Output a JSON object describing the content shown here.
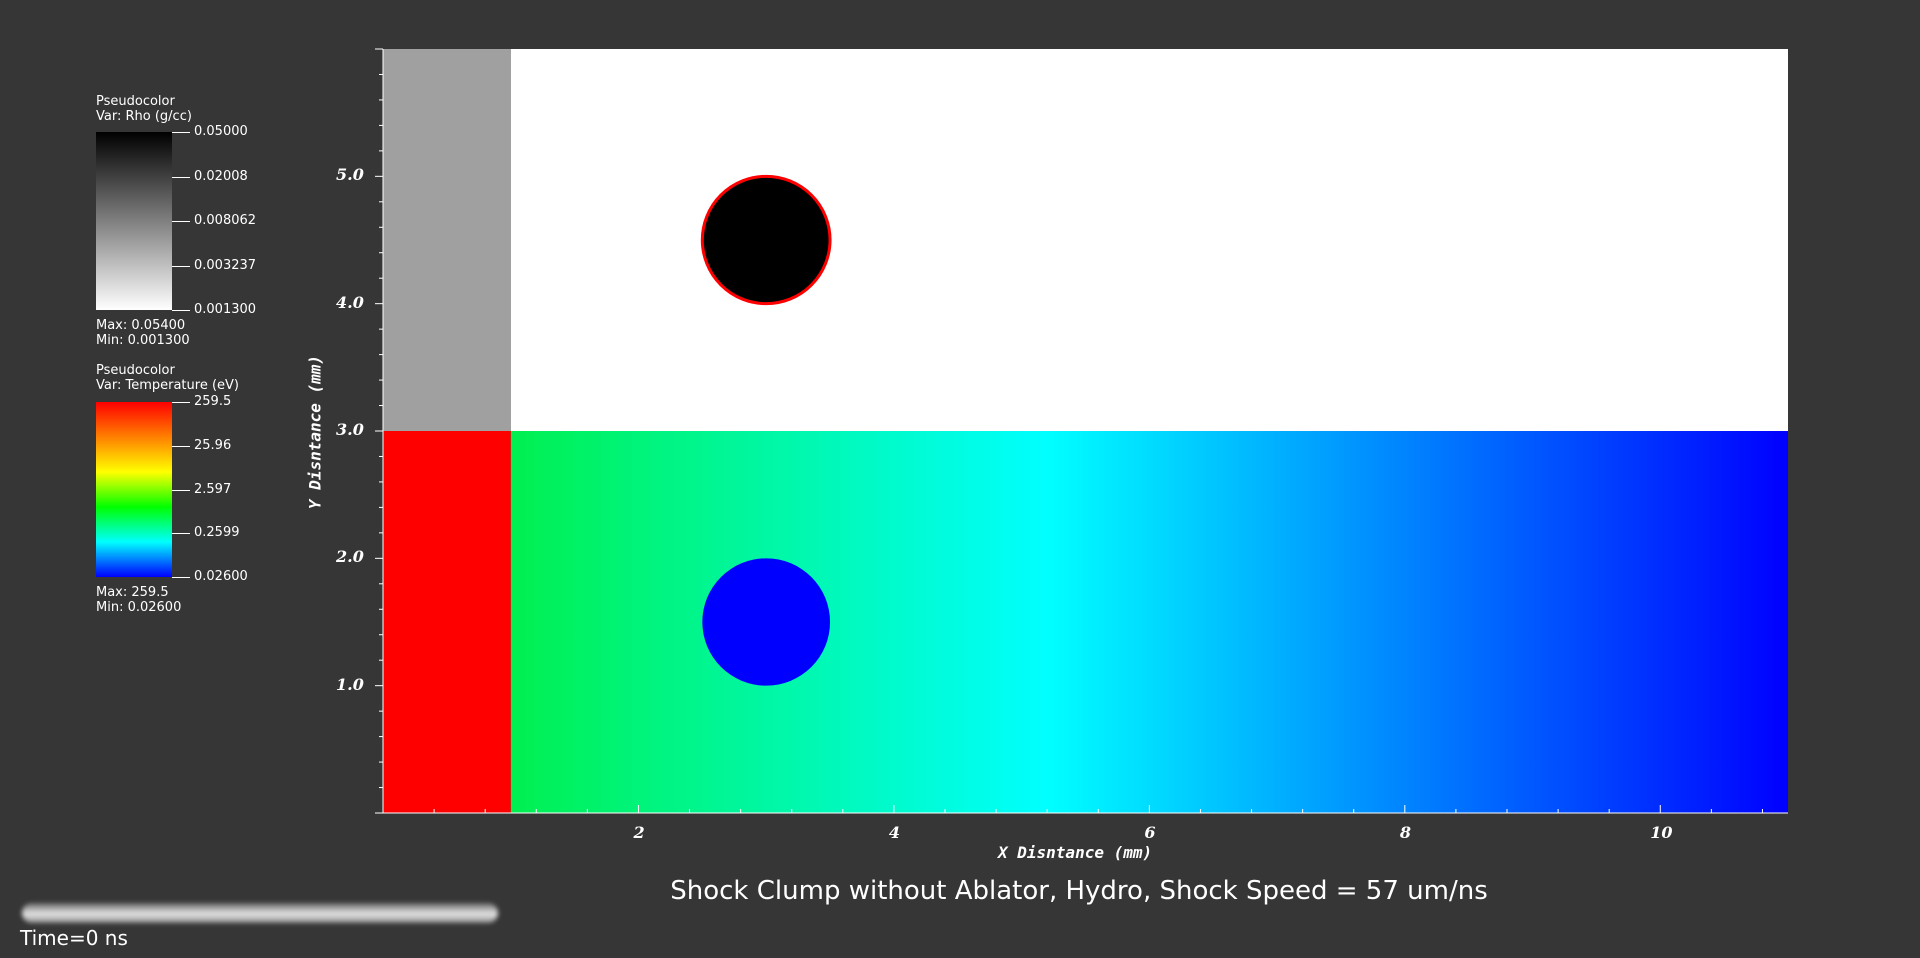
{
  "legends": [
    {
      "plot_type": "Pseudocolor",
      "var_label": "Var: Rho (g/cc)",
      "ticks": [
        "0.05000",
        "0.02008",
        "0.008062",
        "0.003237",
        "0.001300"
      ],
      "max_label": "Max:  0.05400",
      "min_label": "Min:  0.001300",
      "colormap": "gray",
      "colors": [
        "#000000",
        "#ffffff"
      ]
    },
    {
      "plot_type": "Pseudocolor",
      "var_label": "Var: Temperature (eV)",
      "ticks": [
        "259.5",
        "25.96",
        "2.597",
        "0.2599",
        "0.02600"
      ],
      "max_label": "Max:  259.5",
      "min_label": "Min:  0.02600",
      "colormap": "hot-to-cold",
      "colors": [
        "#ff0000",
        "#ff8000",
        "#ffff00",
        "#00ff00",
        "#00ffff",
        "#0000ff"
      ]
    }
  ],
  "axes": {
    "x_title": "X Disntance (mm)",
    "y_title": "Y Disntance (mm)",
    "x_range": [
      0,
      11
    ],
    "y_range": [
      0,
      6
    ],
    "x_tick_labels": [
      "2",
      "4",
      "6",
      "8",
      "10"
    ],
    "y_tick_labels": [
      "1.0",
      "2.0",
      "3.0",
      "4.0",
      "5.0"
    ],
    "x_ticks": [
      2,
      4,
      6,
      8,
      10
    ],
    "y_ticks": [
      1,
      2,
      3,
      4,
      5
    ]
  },
  "regions": {
    "density_half": {
      "y_range": [
        3,
        6
      ],
      "ablator_x_range": [
        0,
        1
      ],
      "ablator_color": "#a0a0a0",
      "background_color": "#ffffff"
    },
    "temperature_half": {
      "y_range": [
        0,
        3
      ],
      "ablator_x_range": [
        0,
        1
      ],
      "ablator_color": "#ff0000",
      "gradient_colors": [
        "#00f050",
        "#00ffff",
        "#0000ff"
      ]
    },
    "clump_density": {
      "cx": 3,
      "cy": 4.5,
      "r": 0.5,
      "fill": "#000000",
      "stroke": "#ff0000"
    },
    "clump_temperature": {
      "cx": 3,
      "cy": 1.5,
      "r": 0.5,
      "fill": "#0000ff"
    }
  },
  "title": "Shock Clump without Ablator, Hydro, Shock Speed = 57 um/ns",
  "time_label": "Time=0 ns"
}
